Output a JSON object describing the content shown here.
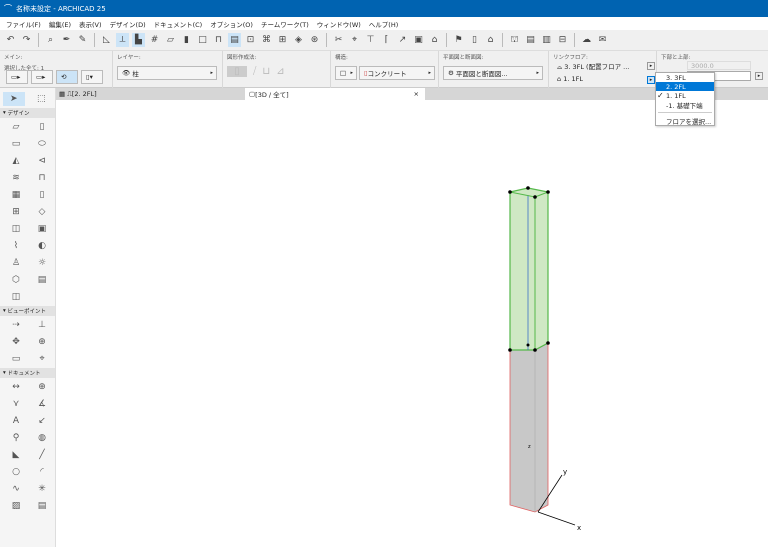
{
  "title": "名称未設定 - ARCHICAD 25",
  "menu": [
    "ファイル(F)",
    "編集(E)",
    "表示(V)",
    "デザイン(D)",
    "ドキュメント(C)",
    "オプション(O)",
    "チームワーク(T)",
    "ウィンドウ(W)",
    "ヘルプ(H)"
  ],
  "infobox": {
    "main_label": "メイン:",
    "selected": "選択した全て: 1",
    "layer_label": "レイヤー:",
    "layer_value": "柱",
    "geometry_label": "図形作成法:",
    "structure_label": "構造:",
    "structure_value": "コンクリート",
    "floorplan_label": "平面図と断面図:",
    "floorplan_value": "平面図と断面図...",
    "link_label": "リンクフロア:",
    "link_top": "3. 3FL (配置フロア ...",
    "link_bottom": "1. 1FL",
    "topbottom_label": "下部と上部:",
    "height_value": "3000.0"
  },
  "tabs": {
    "plan": "[2. 2FL]",
    "view3d": "[3D / 全て]",
    "close": "×"
  },
  "dropdown": {
    "items": [
      "3. 3FL",
      "2. 2FL",
      "1. 1FL",
      "-1. 基礎下端"
    ],
    "highlighted": "2. 2FL",
    "checked": "1. 1FL",
    "choose": "フロアを選択..."
  },
  "toolbox": {
    "sections": [
      {
        "name": "デザイン",
        "icons": [
          "wall-icon",
          "column-icon",
          "beam-icon",
          "slab-icon",
          "roof-icon",
          "shell-icon",
          "stair-icon",
          "railing-icon",
          "curtain-wall-icon",
          "door-icon",
          "window-icon",
          "skylight-icon",
          "corner-window-icon",
          "wall-end-icon",
          "mesh-icon",
          "zone-icon",
          "object-icon",
          "lamp-icon",
          "morph-icon",
          "grid-element-icon",
          "opening-icon"
        ]
      },
      {
        "name": "ビューポイント",
        "icons": [
          "section-icon",
          "elevation-icon",
          "interior-elevation-icon",
          "worksheet-icon",
          "detail-icon",
          "camera-icon"
        ]
      },
      {
        "name": "ドキュメント",
        "icons": [
          "dimension-icon",
          "level-dimension-icon",
          "radial-dimension-icon",
          "angle-dimension-icon",
          "text-icon",
          "label-icon",
          "marker-icon",
          "change-icon",
          "fill-icon",
          "line-icon",
          "circle-icon",
          "arc-icon",
          "spline-icon",
          "hotspot-icon",
          "figure-icon",
          "drawing-icon"
        ]
      }
    ]
  },
  "axes": {
    "x": "x",
    "y": "y",
    "z": "z"
  },
  "colors": {
    "title": "#0063b1",
    "selected": "#7ed957",
    "column": "#c8c8c8"
  }
}
